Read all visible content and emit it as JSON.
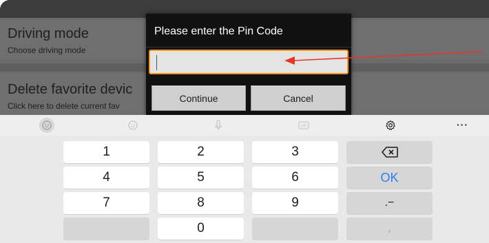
{
  "background": {
    "items": [
      {
        "title": "Driving mode",
        "subtitle": "Choose driving mode"
      },
      {
        "title": "Delete favorite devic",
        "subtitle": "Click here to delete current fav"
      }
    ]
  },
  "dialog": {
    "title": "Please enter the Pin Code",
    "input_value": "",
    "continue_label": "Continue",
    "cancel_label": "Cancel"
  },
  "annotation": {
    "color": "#e8352a"
  },
  "keyboard": {
    "toolbar": {
      "icons": [
        "emoji-icon",
        "sticker-icon",
        "microphone-icon",
        "gif-icon",
        "settings-icon",
        "more-icon"
      ],
      "more_label": "···"
    },
    "keys": {
      "k1": "1",
      "k2": "2",
      "k3": "3",
      "k4": "4",
      "k5": "5",
      "k6": "6",
      "k7": "7",
      "k8": "8",
      "k9": "9",
      "k0": "0",
      "ok": "OK",
      "dot_dash": ".−",
      "comma": ","
    },
    "ok_color": "#2f7cf6"
  }
}
